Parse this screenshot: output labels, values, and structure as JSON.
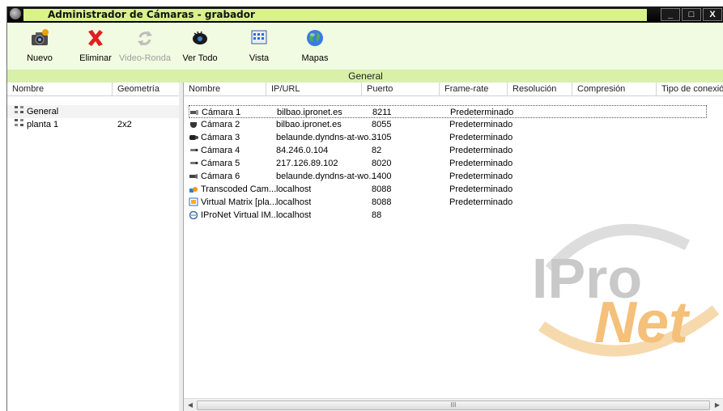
{
  "window": {
    "title": "Administrador de Cámaras - grabador",
    "minimize_label": "_",
    "maximize_label": "□",
    "close_label": "X"
  },
  "toolbar": {
    "buttons": [
      {
        "label": "Nuevo",
        "icon": "camera-new-icon",
        "enabled": true
      },
      {
        "label": "Eliminar",
        "icon": "red-x-icon",
        "enabled": true
      },
      {
        "label": "Video-Ronda",
        "icon": "refresh-arrows-icon",
        "enabled": false
      },
      {
        "label": "Ver Todo",
        "icon": "eye-icon",
        "enabled": true
      },
      {
        "label": "Vista",
        "icon": "grid-view-icon",
        "enabled": true
      },
      {
        "label": "Mapas",
        "icon": "globe-icon",
        "enabled": true
      }
    ]
  },
  "group_header": "General",
  "tree": {
    "columns": [
      "Nombre",
      "Geometría"
    ],
    "items": [
      {
        "name": "General",
        "geometry": ""
      },
      {
        "name": "planta 1",
        "geometry": "2x2"
      }
    ]
  },
  "table": {
    "columns": [
      "Nombre",
      "IP/URL",
      "Puerto",
      "Frame-rate",
      "Resolución",
      "Compresión",
      "Tipo de conexión"
    ],
    "rows": [
      {
        "name": "Cámara 1",
        "ip": "bilbao.ipronet.es",
        "port": "8211",
        "framerate": "Predeterminado",
        "icon": "ptz-camera-icon"
      },
      {
        "name": "Cámara 2",
        "ip": "bilbao.ipronet.es",
        "port": "8055",
        "framerate": "Predeterminado",
        "icon": "dome-camera-icon"
      },
      {
        "name": "Cámara 3",
        "ip": "belaunde.dyndns-at-wo...",
        "port": "3105",
        "framerate": "Predeterminado",
        "icon": "black-camera-icon"
      },
      {
        "name": "Cámara 4",
        "ip": "84.246.0.104",
        "port": "82",
        "framerate": "Predeterminado",
        "icon": "bullet-camera-icon"
      },
      {
        "name": "Cámara 5",
        "ip": "217.126.89.102",
        "port": "8020",
        "framerate": "Predeterminado",
        "icon": "bullet-camera-icon"
      },
      {
        "name": "Cámara 6",
        "ip": "belaunde.dyndns-at-wo...",
        "port": "1400",
        "framerate": "Predeterminado",
        "icon": "box-camera-icon"
      },
      {
        "name": "Transcoded Cam...",
        "ip": "localhost",
        "port": "8088",
        "framerate": "Predeterminado",
        "icon": "transcoded-camera-icon"
      },
      {
        "name": "Virtual Matrix [pla...",
        "ip": "localhost",
        "port": "8088",
        "framerate": "Predeterminado",
        "icon": "virtual-matrix-icon"
      },
      {
        "name": "IProNet Virtual IM...",
        "ip": "localhost",
        "port": "88",
        "framerate": "",
        "icon": "virtual-im-icon"
      }
    ]
  },
  "scrollbar": {
    "grip": "III"
  },
  "watermark": {
    "line1": "IPro",
    "line2": "Net"
  },
  "colors": {
    "title_bar": "#000000",
    "title_highlight": "#d9f28a",
    "toolbar_bg": "#f1fbe1",
    "group_header_bg": "#d8f0a8",
    "watermark_grey": "#c9c9c9",
    "watermark_orange": "#f4c07a"
  }
}
